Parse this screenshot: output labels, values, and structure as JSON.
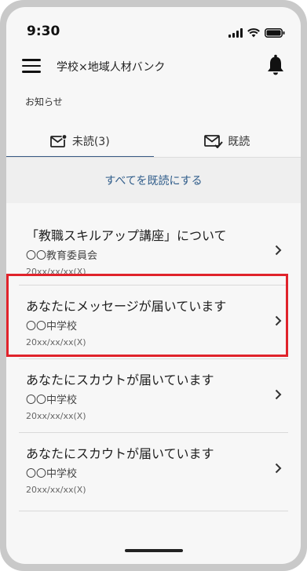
{
  "status_bar": {
    "time": "9:30"
  },
  "header": {
    "menu_icon": "hamburger-menu-icon",
    "title": "学校×地域人材バンク",
    "bell_icon": "bell-icon"
  },
  "section": {
    "label": "お知らせ"
  },
  "tabs": [
    {
      "label": "未読(3)",
      "icon": "mail-unread-icon",
      "active": true
    },
    {
      "label": "既読",
      "icon": "mail-read-icon",
      "active": false
    }
  ],
  "mark_all": {
    "label": "すべてを既読にする"
  },
  "notifications": [
    {
      "title": "「教職スキルアップ講座」について",
      "sender": "〇〇教育委員会",
      "date": "20xx/xx/xx(X)"
    },
    {
      "title": "あなたにメッセージが届いています",
      "sender": "〇〇中学校",
      "date": "20xx/xx/xx(X)",
      "highlighted": true
    },
    {
      "title": "あなたにスカウトが届いています",
      "sender": "〇〇中学校",
      "date": "20xx/xx/xx(X)"
    },
    {
      "title": "あなたにスカウトが届いています",
      "sender": "〇〇中学校",
      "date": "20xx/xx/xx(X)"
    }
  ],
  "colors": {
    "accent": "#2f5c8a",
    "highlight": "#e0232b",
    "frame": "#c9c9c9",
    "screen": "#f7f7f7"
  }
}
